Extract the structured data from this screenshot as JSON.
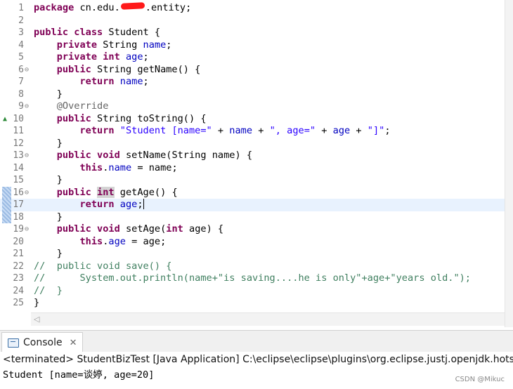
{
  "editor": {
    "lines": [
      {
        "num": "1",
        "fold": "",
        "parts": [
          {
            "t": "package",
            "c": "kw"
          },
          {
            "t": " cn.edu."
          },
          {
            "redact": true
          },
          {
            "t": ".entity;"
          }
        ]
      },
      {
        "num": "2",
        "fold": "",
        "parts": []
      },
      {
        "num": "3",
        "fold": "",
        "parts": [
          {
            "t": "public class",
            "c": "kw"
          },
          {
            "t": " Student {"
          }
        ]
      },
      {
        "num": "4",
        "fold": "",
        "parts": [
          {
            "t": "    "
          },
          {
            "t": "private",
            "c": "kw"
          },
          {
            "t": " String "
          },
          {
            "t": "name",
            "c": "fld"
          },
          {
            "t": ";"
          }
        ]
      },
      {
        "num": "5",
        "fold": "",
        "parts": [
          {
            "t": "    "
          },
          {
            "t": "private int",
            "c": "kw"
          },
          {
            "t": " "
          },
          {
            "t": "age",
            "c": "fld"
          },
          {
            "t": ";"
          }
        ]
      },
      {
        "num": "6",
        "fold": "⊖",
        "parts": [
          {
            "t": "    "
          },
          {
            "t": "public",
            "c": "kw"
          },
          {
            "t": " String getName() {"
          }
        ]
      },
      {
        "num": "7",
        "fold": "",
        "parts": [
          {
            "t": "        "
          },
          {
            "t": "return",
            "c": "kw"
          },
          {
            "t": " "
          },
          {
            "t": "name",
            "c": "fld"
          },
          {
            "t": ";"
          }
        ]
      },
      {
        "num": "8",
        "fold": "",
        "parts": [
          {
            "t": "    }"
          }
        ]
      },
      {
        "num": "9",
        "fold": "⊖",
        "parts": [
          {
            "t": "    "
          },
          {
            "t": "@Override",
            "c": "ann"
          }
        ]
      },
      {
        "num": "10",
        "fold": "",
        "override": "▲",
        "parts": [
          {
            "t": "    "
          },
          {
            "t": "public",
            "c": "kw"
          },
          {
            "t": " String toString() {"
          }
        ]
      },
      {
        "num": "11",
        "fold": "",
        "parts": [
          {
            "t": "        "
          },
          {
            "t": "return",
            "c": "kw"
          },
          {
            "t": " "
          },
          {
            "t": "\"Student [name=\"",
            "c": "str"
          },
          {
            "t": " + "
          },
          {
            "t": "name",
            "c": "fld"
          },
          {
            "t": " + "
          },
          {
            "t": "\", age=\"",
            "c": "str"
          },
          {
            "t": " + "
          },
          {
            "t": "age",
            "c": "fld"
          },
          {
            "t": " + "
          },
          {
            "t": "\"]\"",
            "c": "str"
          },
          {
            "t": ";"
          }
        ]
      },
      {
        "num": "12",
        "fold": "",
        "parts": [
          {
            "t": "    }"
          }
        ]
      },
      {
        "num": "13",
        "fold": "⊖",
        "parts": [
          {
            "t": "    "
          },
          {
            "t": "public void",
            "c": "kw"
          },
          {
            "t": " setName(String name) {"
          }
        ]
      },
      {
        "num": "14",
        "fold": "",
        "parts": [
          {
            "t": "        "
          },
          {
            "t": "this",
            "c": "kw"
          },
          {
            "t": "."
          },
          {
            "t": "name",
            "c": "fld"
          },
          {
            "t": " = name;"
          }
        ]
      },
      {
        "num": "15",
        "fold": "",
        "parts": [
          {
            "t": "    }"
          }
        ]
      },
      {
        "num": "16",
        "fold": "⊖",
        "selected": true,
        "parts": [
          {
            "t": "    "
          },
          {
            "t": "public",
            "c": "kw"
          },
          {
            "t": " "
          },
          {
            "t": "int",
            "c": "kw hl"
          },
          {
            "t": " getAge() {"
          }
        ]
      },
      {
        "num": "17",
        "fold": "",
        "selected": true,
        "current": true,
        "parts": [
          {
            "t": "        "
          },
          {
            "t": "return",
            "c": "kw"
          },
          {
            "t": " "
          },
          {
            "t": "age",
            "c": "fld"
          },
          {
            "t": ";"
          },
          {
            "cursor": true
          }
        ]
      },
      {
        "num": "18",
        "fold": "",
        "selected": true,
        "parts": [
          {
            "t": "    }"
          }
        ]
      },
      {
        "num": "19",
        "fold": "⊖",
        "parts": [
          {
            "t": "    "
          },
          {
            "t": "public void",
            "c": "kw"
          },
          {
            "t": " setAge("
          },
          {
            "t": "int",
            "c": "kw"
          },
          {
            "t": " age) {"
          }
        ]
      },
      {
        "num": "20",
        "fold": "",
        "parts": [
          {
            "t": "        "
          },
          {
            "t": "this",
            "c": "kw"
          },
          {
            "t": "."
          },
          {
            "t": "age",
            "c": "fld"
          },
          {
            "t": " = age;"
          }
        ]
      },
      {
        "num": "21",
        "fold": "",
        "parts": [
          {
            "t": "    }"
          }
        ]
      },
      {
        "num": "22",
        "fold": "",
        "parts": [
          {
            "t": "//  public void save() {",
            "c": "cmt"
          }
        ]
      },
      {
        "num": "23",
        "fold": "",
        "parts": [
          {
            "t": "//      System.out.println(name+\"is saving....he is only\"+age+\"years old.\");",
            "c": "cmt"
          }
        ]
      },
      {
        "num": "24",
        "fold": "",
        "parts": [
          {
            "t": "//  }",
            "c": "cmt"
          }
        ]
      },
      {
        "num": "25",
        "fold": "",
        "parts": [
          {
            "t": "}"
          }
        ]
      }
    ]
  },
  "console": {
    "tab_label": "Console",
    "close_glyph": "✕",
    "status": "<terminated> StudentBizTest [Java Application] C:\\eclipse\\eclipse\\plugins\\org.eclipse.justj.openjdk.hotsp",
    "output": "Student [name=谈婷, age=20]"
  },
  "watermark": "CSDN @Mikuc",
  "scroll": {
    "left_arrow": "◁"
  },
  "icons": {
    "console": "console-icon",
    "close": "close-icon",
    "fold": "fold-collapse-icon",
    "override": "override-marker-icon"
  },
  "colors": {
    "keyword": "#7f0055",
    "field": "#0000c0",
    "string": "#2a00ff",
    "comment": "#3f7f5f",
    "annotation": "#646464",
    "current_line": "#e8f2fe"
  }
}
